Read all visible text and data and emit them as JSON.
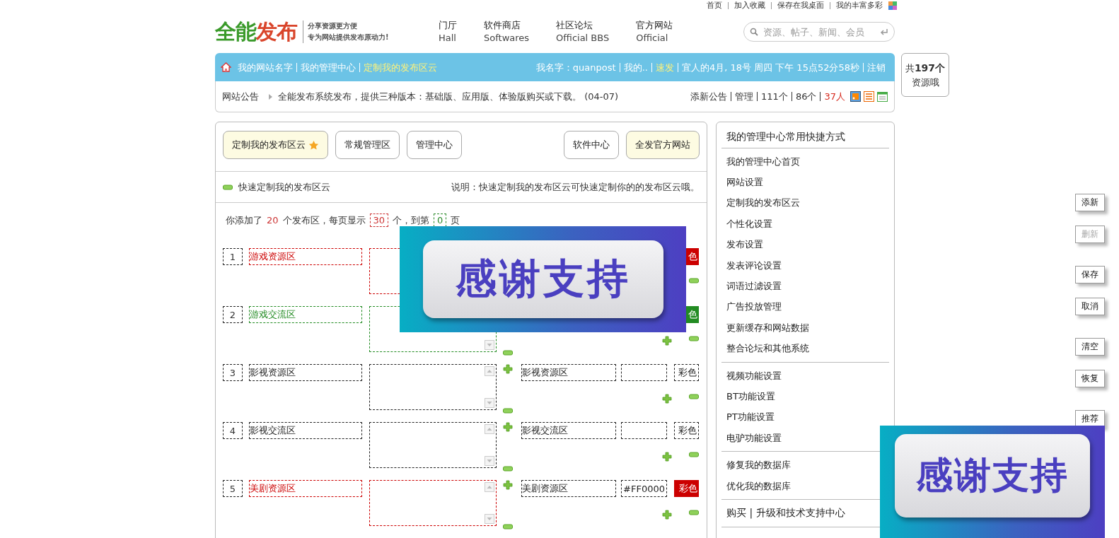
{
  "top_links": [
    "首页",
    "加入收藏",
    "保存在我桌面",
    "我的丰富多彩"
  ],
  "logo": {
    "title_a": "全能",
    "title_b": "发布",
    "tagline_1": "分享资源更方便",
    "tagline_2": "专为网站提供发布原动力!"
  },
  "nav": [
    {
      "label": "门厅",
      "sub": "Hall"
    },
    {
      "label": "软件商店",
      "sub": "Softwares"
    },
    {
      "label": "社区论坛",
      "sub": "Official BBS"
    },
    {
      "label": "官方网站",
      "sub": "Official"
    }
  ],
  "search": {
    "placeholder": "资源、帖子、新闻、会员"
  },
  "user_bar": {
    "left": [
      {
        "label": "我的网站名字",
        "highlighted": false
      },
      {
        "label": "我的管理中心",
        "highlighted": false
      },
      {
        "label": "定制我的发布区云",
        "highlighted": true
      }
    ],
    "right": [
      {
        "label": "我名字：quanpost",
        "highlighted": false
      },
      {
        "label": "我的..",
        "highlighted": false
      },
      {
        "label": "速发",
        "highlighted": true
      },
      {
        "label": "宜人的4月, 18号 周四 下午 15点52分58秒",
        "highlighted": false
      },
      {
        "label": "注销",
        "highlighted": false
      }
    ]
  },
  "notice": {
    "label": "网站公告",
    "text": "全能发布系统发布，提供三种版本：基础版、应用版、体验版购买或下载。 (04-07)",
    "links": [
      {
        "label": "添新公告",
        "alert": false
      },
      {
        "label": "管理",
        "alert": false
      },
      {
        "label": "111个",
        "alert": false
      },
      {
        "label": "86个",
        "alert": false
      },
      {
        "label": "37人",
        "alert": true
      }
    ]
  },
  "resource_count": {
    "prefix": "共",
    "count": "197个",
    "suffix": "资源哦"
  },
  "tabs_left": [
    {
      "label": "定制我的发布区云",
      "selected": true
    },
    {
      "label": "常规管理区",
      "selected": false
    },
    {
      "label": "管理中心",
      "selected": false
    }
  ],
  "tabs_right": [
    {
      "label": "软件中心",
      "selected": false
    },
    {
      "label": "全发官方网站",
      "selected": true
    }
  ],
  "section": {
    "title": "快速定制我的发布区云",
    "note": "说明：快速定制我的发布区云可快速定制你的的发布区云哦。"
  },
  "summary": {
    "t1": "你添加了",
    "count": "20",
    "t2": "个发布区，每页显示",
    "per_page": "30",
    "t3": "个，到第",
    "page": "0",
    "t4": "页"
  },
  "rows": [
    {
      "number": "1",
      "name": "游戏资源区",
      "color": "#cc0000",
      "colored": true,
      "badge": "色"
    },
    {
      "number": "2",
      "name": "游戏交流区",
      "color": "#228b22",
      "colored": true,
      "badge": "色"
    },
    {
      "number": "3",
      "name": "影视资源区",
      "alias": "影视资源区",
      "color": "#222222",
      "colored": false,
      "badge": "彩色"
    },
    {
      "number": "4",
      "name": "影视交流区",
      "alias": "影视交流区",
      "color": "#222222",
      "colored": false,
      "badge": "彩色"
    },
    {
      "number": "5",
      "name": "美剧资源区",
      "alias": "美剧资源区",
      "hex": "#FF0000",
      "color": "#cc0000",
      "colored": true,
      "badge": "彩色"
    }
  ],
  "sidebar": {
    "title": "我的管理中心常用快捷方式",
    "groups": [
      [
        "我的管理中心首页",
        "网站设置",
        "定制我的发布区云",
        "个性化设置",
        "发布设置",
        "发表评论设置",
        "词语过滤设置",
        "广告投放管理",
        "更新缓存和网站数据",
        "整合论坛和其他系统"
      ],
      [
        "视频功能设置",
        "BT功能设置",
        "PT功能设置",
        "电驴功能设置"
      ],
      [
        "修复我的数据库",
        "优化我的数据库"
      ]
    ],
    "footer": "购买 | 升级和技术支持中心"
  },
  "side_buttons": [
    [
      {
        "label": "添新",
        "disabled": false
      },
      {
        "label": "删新",
        "disabled": true
      }
    ],
    [
      {
        "label": "保存",
        "disabled": false
      },
      {
        "label": "取消",
        "disabled": false
      }
    ],
    [
      {
        "label": "清空",
        "disabled": false
      },
      {
        "label": "恢复",
        "disabled": false
      }
    ],
    [
      {
        "label": "推荐",
        "disabled": false
      }
    ]
  ],
  "floating_ads": [
    {
      "text": "感谢支持"
    },
    {
      "text": "感谢支持"
    }
  ]
}
